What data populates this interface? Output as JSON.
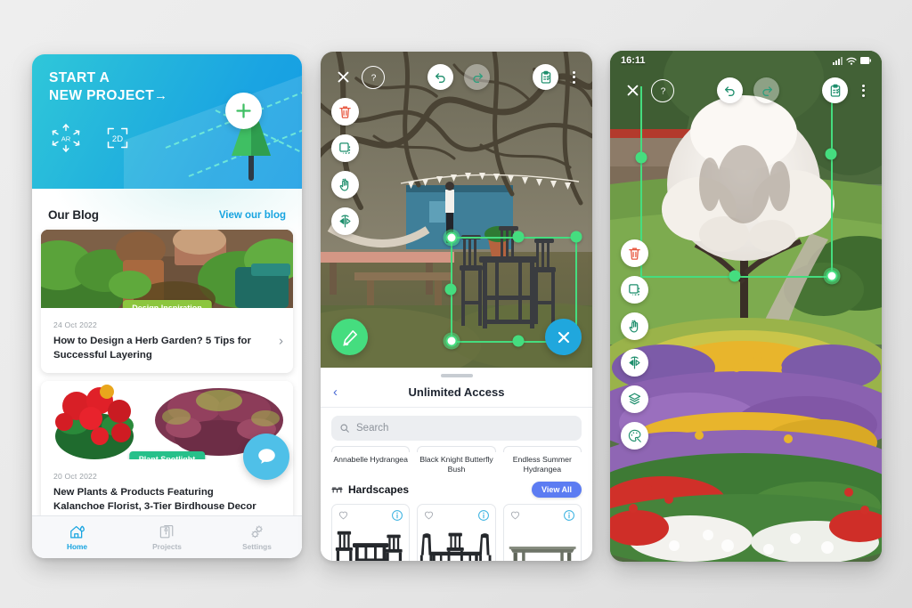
{
  "phone_home": {
    "hero": {
      "title_line1": "START A",
      "title_line2": "NEW PROJECT",
      "arrow": "→",
      "mode_ar_label": "AR",
      "mode_2d_label": "2D",
      "add_icon": "plus-icon",
      "gradient_from": "#2fc7d9",
      "gradient_to": "#139ce4"
    },
    "blog": {
      "heading": "Our Blog",
      "link": "View our blog",
      "link_color": "#18a4e0",
      "posts": [
        {
          "badge": "Design Inspiration",
          "badge_color": "#8cc63f",
          "date": "24 Oct 2022",
          "title": "How to Design a Herb Garden? 5 Tips for Successful Layering",
          "chevron": "›"
        },
        {
          "badge": "Plant Spotlight",
          "badge_color": "#26c08a",
          "date": "20 Oct 2022",
          "title": "New Plants & Products Featuring Kalanchoe Florist, 3-Tier Birdhouse Decor & More!"
        }
      ]
    },
    "chat_fab": {
      "icon": "chat-bubble-icon",
      "color": "#4fc0e8"
    },
    "tabbar": {
      "active_color": "#18a4e0",
      "inactive_color": "#b4bac1",
      "items": [
        {
          "label": "Home",
          "icon": "home-icon",
          "active": true
        },
        {
          "label": "Projects",
          "icon": "projects-icon",
          "active": false
        },
        {
          "label": "Settings",
          "icon": "settings-gears-icon",
          "active": false
        }
      ]
    }
  },
  "phone_ar_catalog": {
    "toolbar": {
      "close": "close-icon",
      "help": "help-circle-icon",
      "undo": "undo-icon",
      "redo": "redo-icon",
      "redo_disabled": true,
      "clipboard": "clipboard-icon",
      "overflow": "more-vertical-icon"
    },
    "rail": [
      {
        "icon": "trash-icon",
        "color": "#e8573f"
      },
      {
        "icon": "duplicate-icon",
        "color": "#1f8f6d"
      },
      {
        "icon": "hand-move-icon",
        "color": "#1f8f6d"
      },
      {
        "icon": "flip-horizontal-icon",
        "color": "#1f8f6d"
      }
    ],
    "pencil_fab": {
      "icon": "pencil-icon",
      "color": "#45dd7f"
    },
    "close_fab": {
      "icon": "close-icon",
      "color": "#20a7dd"
    },
    "selection_color": "#45dd7f",
    "sheet": {
      "back": "‹",
      "title": "Unlimited Access",
      "search_placeholder": "Search",
      "plants": [
        "Annabelle Hydrangea",
        "Black Knight Butterfly Bush",
        "Endless Summer Hydrangea"
      ],
      "section": {
        "icon": "hardscape-icon",
        "title": "Hardscapes",
        "view_all": "View All",
        "view_all_color": "#5c7cf2"
      },
      "products": [
        {
          "name": "counter-height-dining-set",
          "fav": "heart-outline-icon",
          "info": "info-circle-icon"
        },
        {
          "name": "dining-table-with-chairs",
          "fav": "heart-outline-icon",
          "info": "info-circle-icon"
        },
        {
          "name": "rectangular-patio-table",
          "fav": "heart-outline-icon",
          "info": "info-circle-icon"
        }
      ]
    }
  },
  "phone_ar_scene": {
    "statusbar": {
      "time": "16:11",
      "signal": "signal-icon",
      "wifi": "wifi-icon",
      "battery": "battery-icon"
    },
    "toolbar": {
      "close": "close-icon",
      "help": "help-circle-icon",
      "undo": "undo-icon",
      "redo": "redo-icon",
      "redo_disabled": true,
      "clipboard": "clipboard-icon",
      "overflow": "more-vertical-icon"
    },
    "rail": [
      {
        "icon": "trash-icon",
        "color": "#e8573f"
      },
      {
        "icon": "duplicate-icon",
        "color": "#1f8f6d"
      },
      {
        "icon": "hand-move-icon",
        "color": "#1f8f6d"
      },
      {
        "icon": "flip-horizontal-icon",
        "color": "#1f8f6d"
      },
      {
        "icon": "layers-icon",
        "color": "#1f8f6d"
      },
      {
        "icon": "color-palette-icon",
        "color": "#1f8f6d"
      }
    ],
    "selection_color": "#45dd7f"
  }
}
